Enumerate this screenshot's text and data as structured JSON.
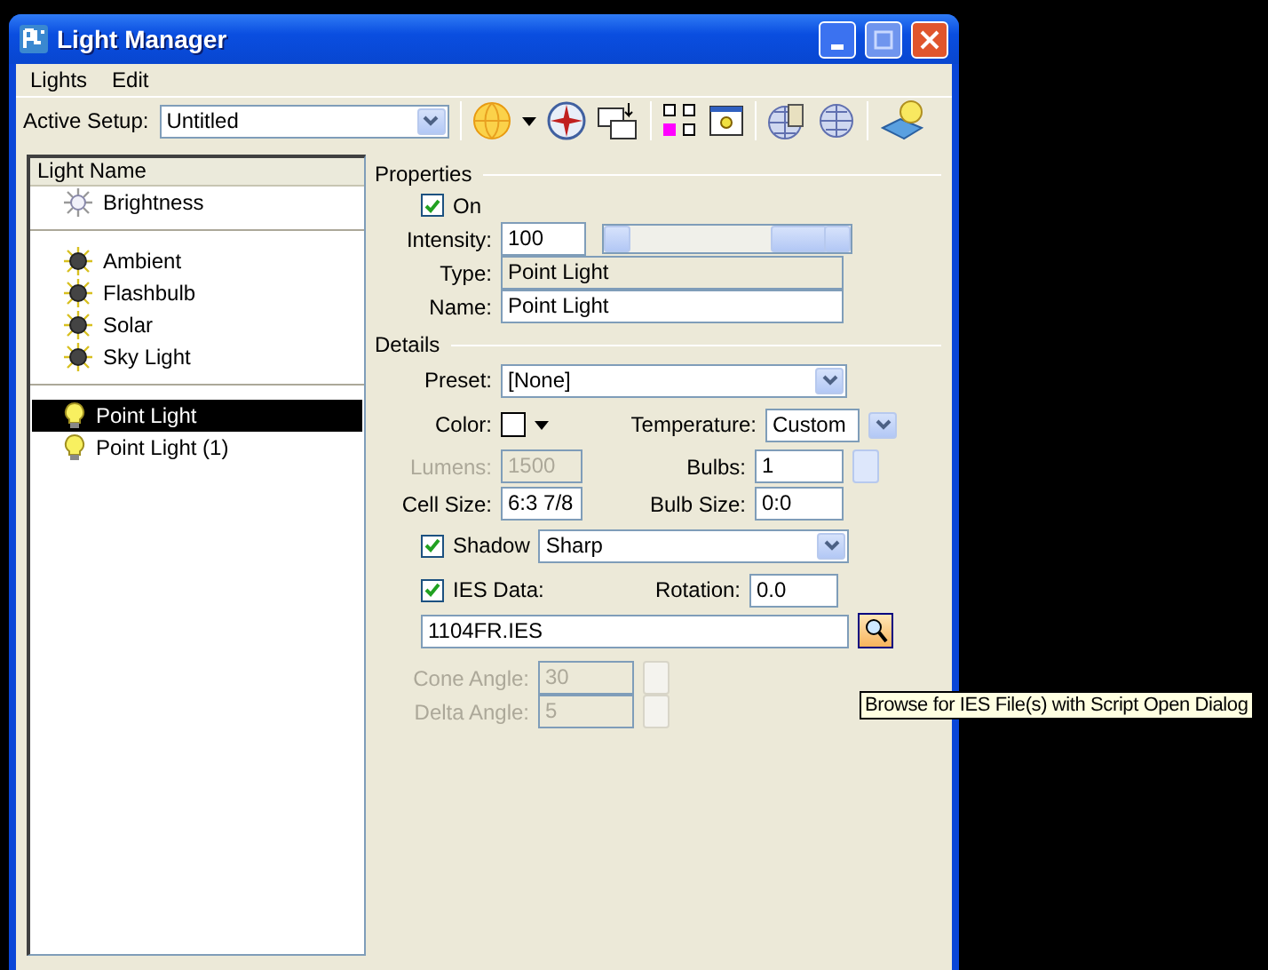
{
  "window": {
    "title": "Light Manager"
  },
  "menu": [
    "Lights",
    "Edit"
  ],
  "toolbar": {
    "label": "Active Setup:",
    "value": "Untitled"
  },
  "light_list": {
    "header": "Light Name",
    "groups": [
      [
        {
          "name": "Brightness",
          "kind": "brightness",
          "selected": false
        }
      ],
      [
        {
          "name": "Ambient",
          "kind": "global",
          "selected": false
        },
        {
          "name": "Flashbulb",
          "kind": "global",
          "selected": false
        },
        {
          "name": "Solar",
          "kind": "global",
          "selected": false
        },
        {
          "name": "Sky Light",
          "kind": "global",
          "selected": false
        }
      ],
      [
        {
          "name": "Point Light",
          "kind": "bulb",
          "selected": true
        },
        {
          "name": "Point Light (1)",
          "kind": "bulb",
          "selected": false
        }
      ]
    ]
  },
  "properties": {
    "title": "Properties",
    "on": {
      "label": "On",
      "checked": true
    },
    "intensity": {
      "label": "Intensity:",
      "value": "100",
      "level": 0.88
    },
    "type": {
      "label": "Type:",
      "value": "Point Light",
      "disabled": true
    },
    "name": {
      "label": "Name:",
      "value": "Point Light",
      "disabled": false
    }
  },
  "details": {
    "title": "Details",
    "preset": {
      "label": "Preset:",
      "value": "[None]"
    },
    "color": {
      "label": "Color:"
    },
    "temperature": {
      "label": "Temperature:",
      "value": "Custom"
    },
    "lumens": {
      "label": "Lumens:",
      "value": "1500",
      "disabled": true
    },
    "bulbs": {
      "label": "Bulbs:",
      "value": "1",
      "disabled": false
    },
    "cell_size": {
      "label": "Cell Size:",
      "value": "6:3 7/8",
      "disabled": false
    },
    "bulb_size": {
      "label": "Bulb Size:",
      "value": "0:0",
      "disabled": false
    },
    "shadow": {
      "label": "Shadow",
      "checked": true,
      "value": "Sharp"
    },
    "ies_data": {
      "label": "IES Data:",
      "checked": true
    },
    "rotation": {
      "label": "Rotation:",
      "value": "0.0",
      "disabled": false
    },
    "ies_file": {
      "value": "1104FR.IES"
    },
    "cone_angle": {
      "label": "Cone Angle:",
      "value": "30",
      "disabled": true
    },
    "delta_angle": {
      "label": "Delta Angle:",
      "value": "5",
      "disabled": true
    }
  },
  "tooltip": "Browse for IES File(s) with Script Open Dialog"
}
